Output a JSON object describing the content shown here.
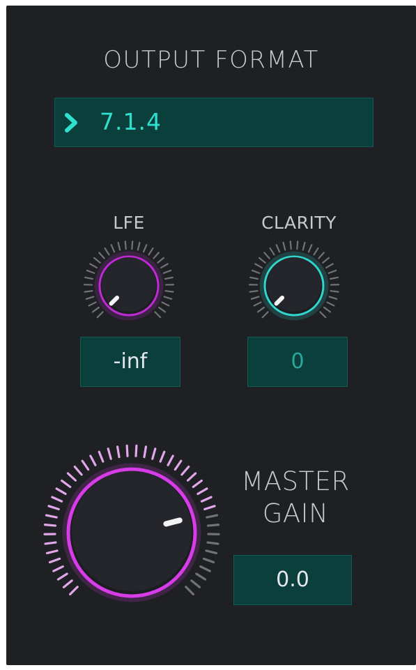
{
  "output_format": {
    "title": "OUTPUT FORMAT",
    "selected": "7.1.4",
    "chevron_icon": "chevron-right-icon"
  },
  "lfe": {
    "label": "LFE",
    "value_text": "-inf",
    "knob_level": 0.0,
    "ring_color": "#c02ad6",
    "tick_color": "#8e8f96"
  },
  "clarity": {
    "label": "CLARITY",
    "value_text": "0",
    "knob_level": 0.0,
    "ring_color": "#2fd6cc",
    "tick_color": "#8e8f96"
  },
  "master_gain": {
    "label_line1": "MASTER",
    "label_line2": "GAIN",
    "value_text": "0.0",
    "knob_level": 0.78,
    "ring_color": "#d63ce8",
    "tick_active_color": "#e2a7ea",
    "tick_inactive_color": "#8e8f96"
  },
  "colors": {
    "background": "#1f2024",
    "field_bg": "#0b3f3c",
    "accent_teal": "#2fe0d0",
    "text": "#c7cacd"
  }
}
